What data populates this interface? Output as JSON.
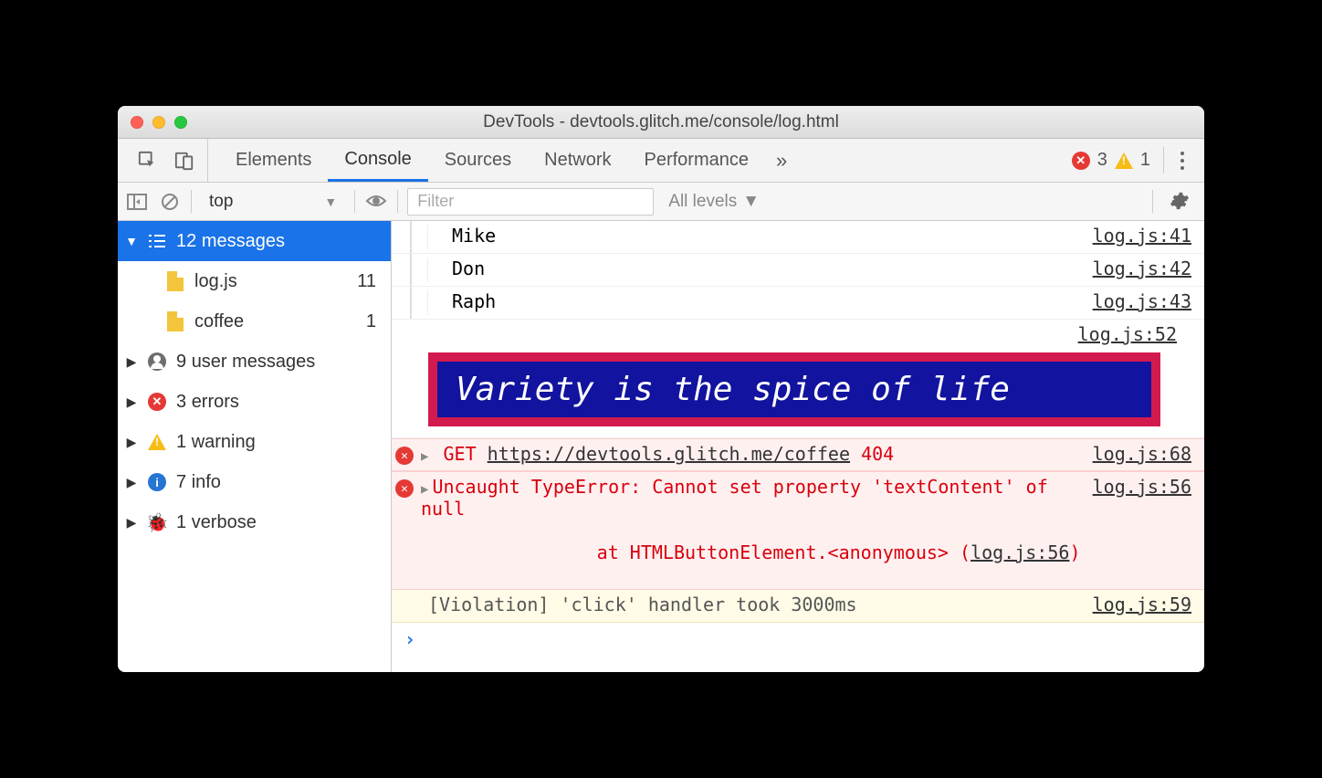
{
  "window": {
    "title": "DevTools - devtools.glitch.me/console/log.html"
  },
  "toolbar": {
    "tabs": [
      "Elements",
      "Console",
      "Sources",
      "Network",
      "Performance"
    ],
    "active_tab": "Console",
    "more": "»",
    "error_count": "3",
    "warning_count": "1"
  },
  "filterbar": {
    "context": "top",
    "filter_placeholder": "Filter",
    "levels": "All levels"
  },
  "sidebar": {
    "header": {
      "count": "12",
      "label": "messages"
    },
    "files": [
      {
        "name": "log.js",
        "count": "11"
      },
      {
        "name": "coffee",
        "count": "1"
      }
    ],
    "categories": [
      {
        "icon": "user",
        "count": "9",
        "label": "user messages"
      },
      {
        "icon": "error",
        "count": "3",
        "label": "errors"
      },
      {
        "icon": "warning",
        "count": "1",
        "label": "warning"
      },
      {
        "icon": "info",
        "count": "7",
        "label": "info"
      },
      {
        "icon": "verbose",
        "count": "1",
        "label": "verbose"
      }
    ]
  },
  "console": {
    "groupA": [
      {
        "text": "Mike",
        "src": "log.js:41"
      },
      {
        "text": "Don",
        "src": "log.js:42"
      },
      {
        "text": "Raph",
        "src": "log.js:43"
      }
    ],
    "styled": {
      "text": "Variety is the spice of life",
      "src": "log.js:52"
    },
    "err_net": {
      "method": "GET",
      "url": "https://devtools.glitch.me/coffee",
      "status": "404",
      "src": "log.js:68"
    },
    "err_type": {
      "head": "Uncaught TypeError: Cannot set property 'textContent' of null",
      "stack": "    at HTMLButtonElement.<anonymous> (",
      "stack_src": "log.js:56",
      "stack_end": ")",
      "src": "log.js:56"
    },
    "violation": {
      "text": "[Violation] 'click' handler took 3000ms",
      "src": "log.js:59"
    }
  }
}
